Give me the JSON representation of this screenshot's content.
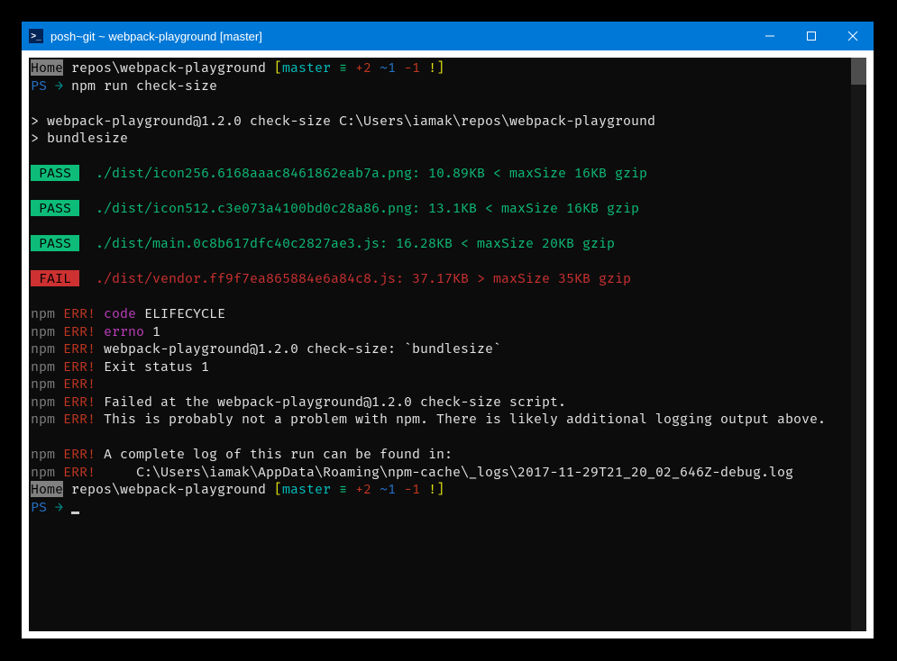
{
  "window_title": "posh~git ~ webpack-playground [master]",
  "prompt1": {
    "home": "Home",
    "path": " repos\\webpack-playground ",
    "bracket_open": "[",
    "branch": "master",
    "equiv": " ≡ ",
    "plus": "+2",
    "tilde": " ~1",
    "minus": " -1",
    "bang": " !",
    "bracket_close": "]"
  },
  "ps_line": {
    "ps": "PS",
    "arrow": " → ",
    "cmd": "npm run check-size"
  },
  "blank": " ",
  "run_line1": "> webpack-playground@1.2.0 check-size C:\\Users\\iamak\\repos\\webpack-playground",
  "run_line2": "> bundlesize",
  "results": [
    {
      "tag": " PASS ",
      "pass": true,
      "text": "  ./dist/icon256.6168aaac8461862eab7a.png: 10.89KB < maxSize 16KB gzip"
    },
    {
      "tag": " PASS ",
      "pass": true,
      "text": "  ./dist/icon512.c3e073a4100bd0c28a86.png: 13.1KB < maxSize 16KB gzip"
    },
    {
      "tag": " PASS ",
      "pass": true,
      "text": "  ./dist/main.0c8b617dfc40c2827ae3.js: 16.28KB < maxSize 20KB gzip"
    },
    {
      "tag": " FAIL ",
      "pass": false,
      "text": "  ./dist/vendor.ff9f7ea865884e6a84c8.js: 37.17KB > maxSize 35KB gzip"
    }
  ],
  "npm": "npm",
  "err": " ERR!",
  "err_lines": [
    {
      "label": " code",
      "label_cls": "magenta",
      "rest": " ELIFECYCLE"
    },
    {
      "label": " errno",
      "label_cls": "magenta",
      "rest": " 1"
    },
    {
      "rest": " webpack-playground@1.2.0 check-size: `bundlesize`"
    },
    {
      "rest": " Exit status 1"
    },
    {
      "rest": ""
    },
    {
      "rest": " Failed at the webpack-playground@1.2.0 check-size script."
    }
  ],
  "err_multiline": " This is probably not a problem with npm. There is likely additional logging output above.",
  "err_log_head": " A complete log of this run can be found in:",
  "err_log_path": "     C:\\Users\\iamak\\AppData\\Roaming\\npm-cache\\_logs\\2017-11-29T21_20_02_646Z-debug.log",
  "ps_line2": {
    "ps": "PS",
    "arrow": " → "
  }
}
